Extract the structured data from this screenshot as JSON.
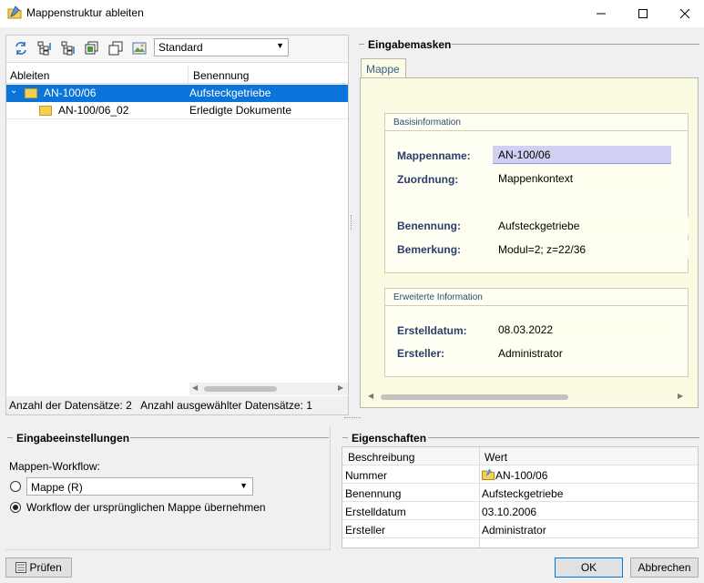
{
  "window": {
    "title": "Mappenstruktur ableiten",
    "controls": [
      "minimize",
      "maximize",
      "close"
    ]
  },
  "toolbar": {
    "icons": [
      "sync-icon",
      "expand-tree-icon",
      "collapse-tree-icon",
      "copy-icon",
      "duplicate-icon",
      "image-icon"
    ],
    "view_select": "Standard"
  },
  "tree": {
    "columns": [
      "Ableiten",
      "Benennung"
    ],
    "rows": [
      {
        "id": "AN-100/06",
        "name": "Aufsteckgetriebe",
        "selected": true
      },
      {
        "id": "AN-100/06_02",
        "name": "Erledigte Dokumente",
        "selected": false
      }
    ],
    "status": "Anzahl der Datensätze: 2   Anzahl ausgewählter Datensätze: 1"
  },
  "masks": {
    "group_title": "Eingabemasken",
    "tab": "Mappe",
    "basis": {
      "title": "Basisinformation",
      "mappenname_label": "Mappenname:",
      "mappenname_value": "AN-100/06",
      "zuordnung_label": "Zuordnung:",
      "zuordnung_value": "Mappenkontext",
      "benennung_label": "Benennung:",
      "benennung_value": "Aufsteckgetriebe",
      "bemerkung_label": "Bemerkung:",
      "bemerkung_value": "Modul=2; z=22/36"
    },
    "extended": {
      "title": "Erweiterte Information",
      "erstelldatum_label": "Erstelldatum:",
      "erstelldatum_value": "08.03.2022",
      "ersteller_label": "Ersteller:",
      "ersteller_value": "Administrator"
    }
  },
  "input_settings": {
    "group_title": "Eingabeeinstellungen",
    "workflow_label": "Mappen-Workflow:",
    "workflow_select": "Mappe (R)",
    "option_original": "Workflow der ursprünglichen Mappe übernehmen"
  },
  "properties": {
    "group_title": "Eigenschaften",
    "columns": [
      "Beschreibung",
      "Wert"
    ],
    "rows": [
      {
        "k": "Nummer",
        "v": "AN-100/06"
      },
      {
        "k": "Benennung",
        "v": "Aufsteckgetriebe"
      },
      {
        "k": "Erstelldatum",
        "v": "03.10.2006"
      },
      {
        "k": "Ersteller",
        "v": "Administrator"
      }
    ]
  },
  "buttons": {
    "check": "Prüfen",
    "ok": "OK",
    "cancel": "Abbrechen"
  }
}
